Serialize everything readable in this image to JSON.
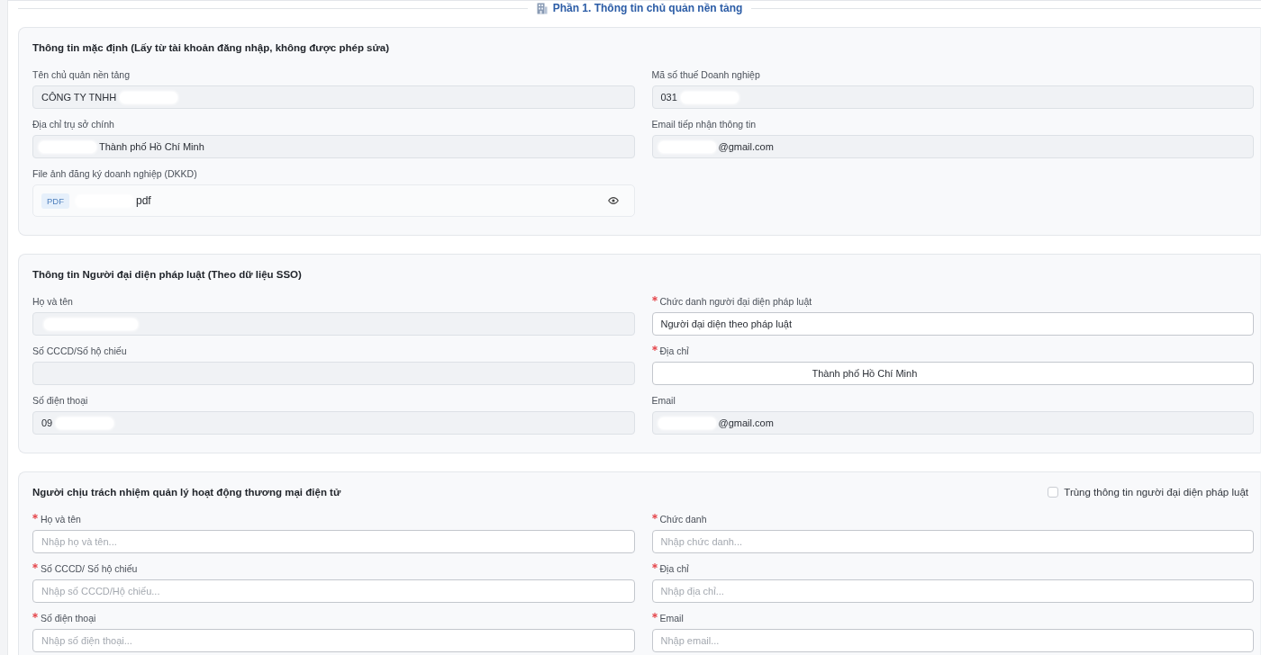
{
  "section_heading": {
    "title": "Phần 1. Thông tin chủ quản nền tảng"
  },
  "cards": [
    {
      "title": "Thông tin mặc định (Lấy từ tài khoản đăng nhập, không được phép sửa)",
      "fields": [
        {
          "kind": "readonly",
          "label": "Tên chủ quản nền tảng",
          "required": false,
          "value": "CÔNG TY TNHH",
          "mask_before": false,
          "mask_after": true
        },
        {
          "kind": "readonly",
          "label": "Mã số thuế Doanh nghiệp",
          "required": false,
          "value": "031",
          "mask_before": false,
          "mask_after": true
        },
        {
          "kind": "readonly",
          "label": "Địa chỉ trụ sở chính",
          "required": false,
          "value": "Thành phố Hồ Chí Minh",
          "mask_before": true,
          "mask_after": false
        },
        {
          "kind": "readonly",
          "label": "Email tiếp nhận thông tin",
          "required": false,
          "value": "@gmail.com",
          "mask_before": true,
          "mask_after": false
        },
        {
          "kind": "file",
          "label": "File ảnh đăng ký doanh nghiệp (DKKD)",
          "required": false,
          "file_type": "PDF",
          "value": "pdf",
          "mask_before": true,
          "mask_after": false
        }
      ]
    },
    {
      "title": "Thông tin Người đại diện pháp luật (Theo dữ liệu SSO)",
      "fields": [
        {
          "kind": "readonly",
          "label": "Họ và tên",
          "required": false,
          "mask_before": true,
          "mask_after": false
        },
        {
          "kind": "input",
          "label": "Chức danh người đại diện pháp luật",
          "required": true,
          "value": "Người đại diện theo pháp luật",
          "mask_before": false,
          "mask_after": false
        },
        {
          "kind": "readonly",
          "label": "Số CCCD/Số hộ chiếu",
          "required": false,
          "mask_before": false,
          "mask_after": false
        },
        {
          "kind": "input",
          "label": "Địa chỉ",
          "required": true,
          "value": "Thành phố Hồ Chí Minh",
          "mask_before": true,
          "mask_after": false
        },
        {
          "kind": "readonly",
          "label": "Số điện thoại",
          "required": false,
          "value": "09",
          "mask_before": false,
          "mask_after": true
        },
        {
          "kind": "readonly",
          "label": "Email",
          "required": false,
          "value": "@gmail.com",
          "mask_before": true,
          "mask_after": false
        }
      ]
    },
    {
      "title": "Người chịu trách nhiệm quản lý hoạt động thương mại điện tử",
      "checkbox": {
        "label": "Trùng thông tin người đại diện pháp luật",
        "checked": false
      },
      "fields": [
        {
          "kind": "input",
          "label": "Họ và tên",
          "required": true,
          "placeholder": "Nhập họ và tên..."
        },
        {
          "kind": "input",
          "label": "Chức danh",
          "required": true,
          "placeholder": "Nhập chức danh..."
        },
        {
          "kind": "input",
          "label": "Số CCCD/ Số hộ chiếu",
          "required": true,
          "placeholder": "Nhập số CCCD/Hộ chiếu..."
        },
        {
          "kind": "input",
          "label": "Địa chỉ",
          "required": true,
          "placeholder": "Nhập địa chỉ..."
        },
        {
          "kind": "input",
          "label": "Số điện thoại",
          "required": true,
          "placeholder": "Nhập số điện thoại..."
        },
        {
          "kind": "input",
          "label": "Email",
          "required": true,
          "placeholder": "Nhập email..."
        }
      ]
    }
  ]
}
